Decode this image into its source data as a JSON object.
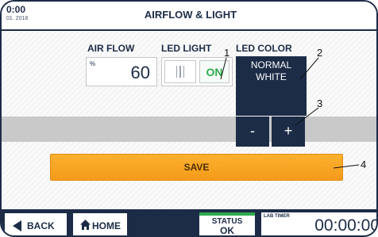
{
  "header": {
    "time": "0:00",
    "date": "01. 2018",
    "title": "AIRFLOW & LIGHT"
  },
  "controls": {
    "airflow": {
      "label": "AIR FLOW",
      "unit": "%",
      "value": "60"
    },
    "led_light": {
      "label": "LED LIGHT",
      "state": "ON"
    },
    "led_color": {
      "label": "LED COLOR",
      "value_line1": "NORMAL",
      "value_line2": "WHITE",
      "minus": "-",
      "plus": "+"
    },
    "save_label": "SAVE"
  },
  "callouts": [
    "1",
    "2",
    "3",
    "4"
  ],
  "footer": {
    "back_label": "BACK",
    "home_label": "HOME",
    "status_label": "STATUS",
    "status_value": "OK",
    "timer_label": "LAB TIMER",
    "timer_value": "00:00:00"
  },
  "colors": {
    "navy": "#1c2c47",
    "accent_green": "#2eaa4f",
    "save_orange": "#f7a21e"
  },
  "icons": [
    "back-arrow-icon",
    "home-icon",
    "toggle-grip-icon"
  ]
}
